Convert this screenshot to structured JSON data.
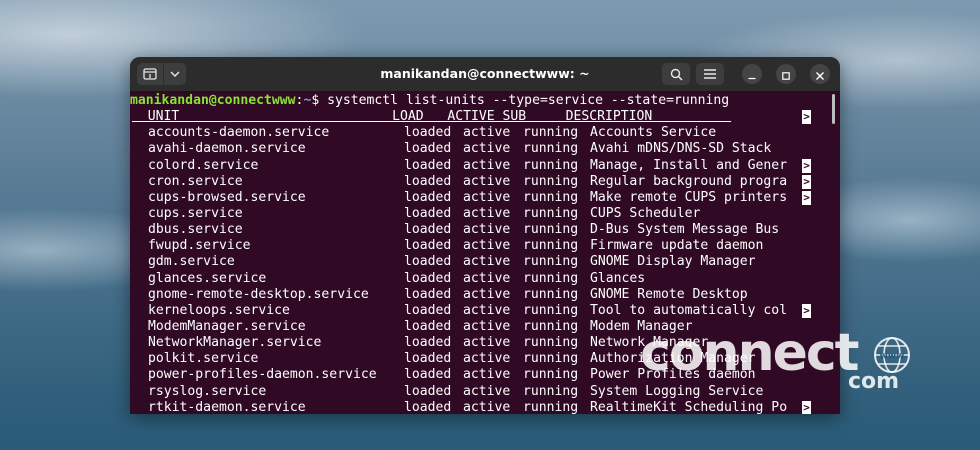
{
  "window": {
    "title": "manikandan@connectwww: ~"
  },
  "terminal": {
    "prompt_user": "manikandan@connectwww",
    "prompt_colon": ":",
    "prompt_path": "~",
    "prompt_symbol": "$ ",
    "command": "systemctl list-units --type=service --state=running",
    "columns": [
      "UNIT",
      "LOAD",
      "ACTIVE",
      "SUB",
      "DESCRIPTION"
    ],
    "header_line": "  UNIT                           LOAD   ACTIVE SUB     DESCRIPTION          ",
    "truncation_marker": ">",
    "rows": [
      {
        "unit": "accounts-daemon.service",
        "load": "loaded",
        "active": "active",
        "sub": "running",
        "description": "Accounts Service",
        "truncated": false
      },
      {
        "unit": "avahi-daemon.service",
        "load": "loaded",
        "active": "active",
        "sub": "running",
        "description": "Avahi mDNS/DNS-SD Stack",
        "truncated": false
      },
      {
        "unit": "colord.service",
        "load": "loaded",
        "active": "active",
        "sub": "running",
        "description": "Manage, Install and Gener",
        "truncated": true
      },
      {
        "unit": "cron.service",
        "load": "loaded",
        "active": "active",
        "sub": "running",
        "description": "Regular background progra",
        "truncated": true
      },
      {
        "unit": "cups-browsed.service",
        "load": "loaded",
        "active": "active",
        "sub": "running",
        "description": "Make remote CUPS printers",
        "truncated": true
      },
      {
        "unit": "cups.service",
        "load": "loaded",
        "active": "active",
        "sub": "running",
        "description": "CUPS Scheduler",
        "truncated": false
      },
      {
        "unit": "dbus.service",
        "load": "loaded",
        "active": "active",
        "sub": "running",
        "description": "D-Bus System Message Bus",
        "truncated": false
      },
      {
        "unit": "fwupd.service",
        "load": "loaded",
        "active": "active",
        "sub": "running",
        "description": "Firmware update daemon",
        "truncated": false
      },
      {
        "unit": "gdm.service",
        "load": "loaded",
        "active": "active",
        "sub": "running",
        "description": "GNOME Display Manager",
        "truncated": false
      },
      {
        "unit": "glances.service",
        "load": "loaded",
        "active": "active",
        "sub": "running",
        "description": "Glances",
        "truncated": false
      },
      {
        "unit": "gnome-remote-desktop.service",
        "load": "loaded",
        "active": "active",
        "sub": "running",
        "description": "GNOME Remote Desktop",
        "truncated": false
      },
      {
        "unit": "kerneloops.service",
        "load": "loaded",
        "active": "active",
        "sub": "running",
        "description": "Tool to automatically col",
        "truncated": true
      },
      {
        "unit": "ModemManager.service",
        "load": "loaded",
        "active": "active",
        "sub": "running",
        "description": "Modem Manager",
        "truncated": false
      },
      {
        "unit": "NetworkManager.service",
        "load": "loaded",
        "active": "active",
        "sub": "running",
        "description": "Network Manager",
        "truncated": false
      },
      {
        "unit": "polkit.service",
        "load": "loaded",
        "active": "active",
        "sub": "running",
        "description": "Authorization Manager",
        "truncated": false
      },
      {
        "unit": "power-profiles-daemon.service",
        "load": "loaded",
        "active": "active",
        "sub": "running",
        "description": "Power Profiles daemon",
        "truncated": false
      },
      {
        "unit": "rsyslog.service",
        "load": "loaded",
        "active": "active",
        "sub": "running",
        "description": "System Logging Service",
        "truncated": false
      },
      {
        "unit": "rtkit-daemon.service",
        "load": "loaded",
        "active": "active",
        "sub": "running",
        "description": "RealtimeKit Scheduling Po",
        "truncated": true
      }
    ]
  },
  "watermark": {
    "brand": "connect",
    "tld": "com",
    "globe_label": "www"
  },
  "colors": {
    "terminal_bg": "#300a24",
    "titlebar_bg": "#2c2c2c",
    "prompt_user": "#8ae234",
    "prompt_path": "#729fcf",
    "text": "#ffffff"
  },
  "icons": {
    "new_tab": "new-tab-icon",
    "dropdown": "chevron-down-icon",
    "search": "search-icon",
    "menu": "hamburger-menu-icon",
    "minimize": "minimize-icon",
    "maximize": "maximize-icon",
    "close": "close-icon"
  }
}
